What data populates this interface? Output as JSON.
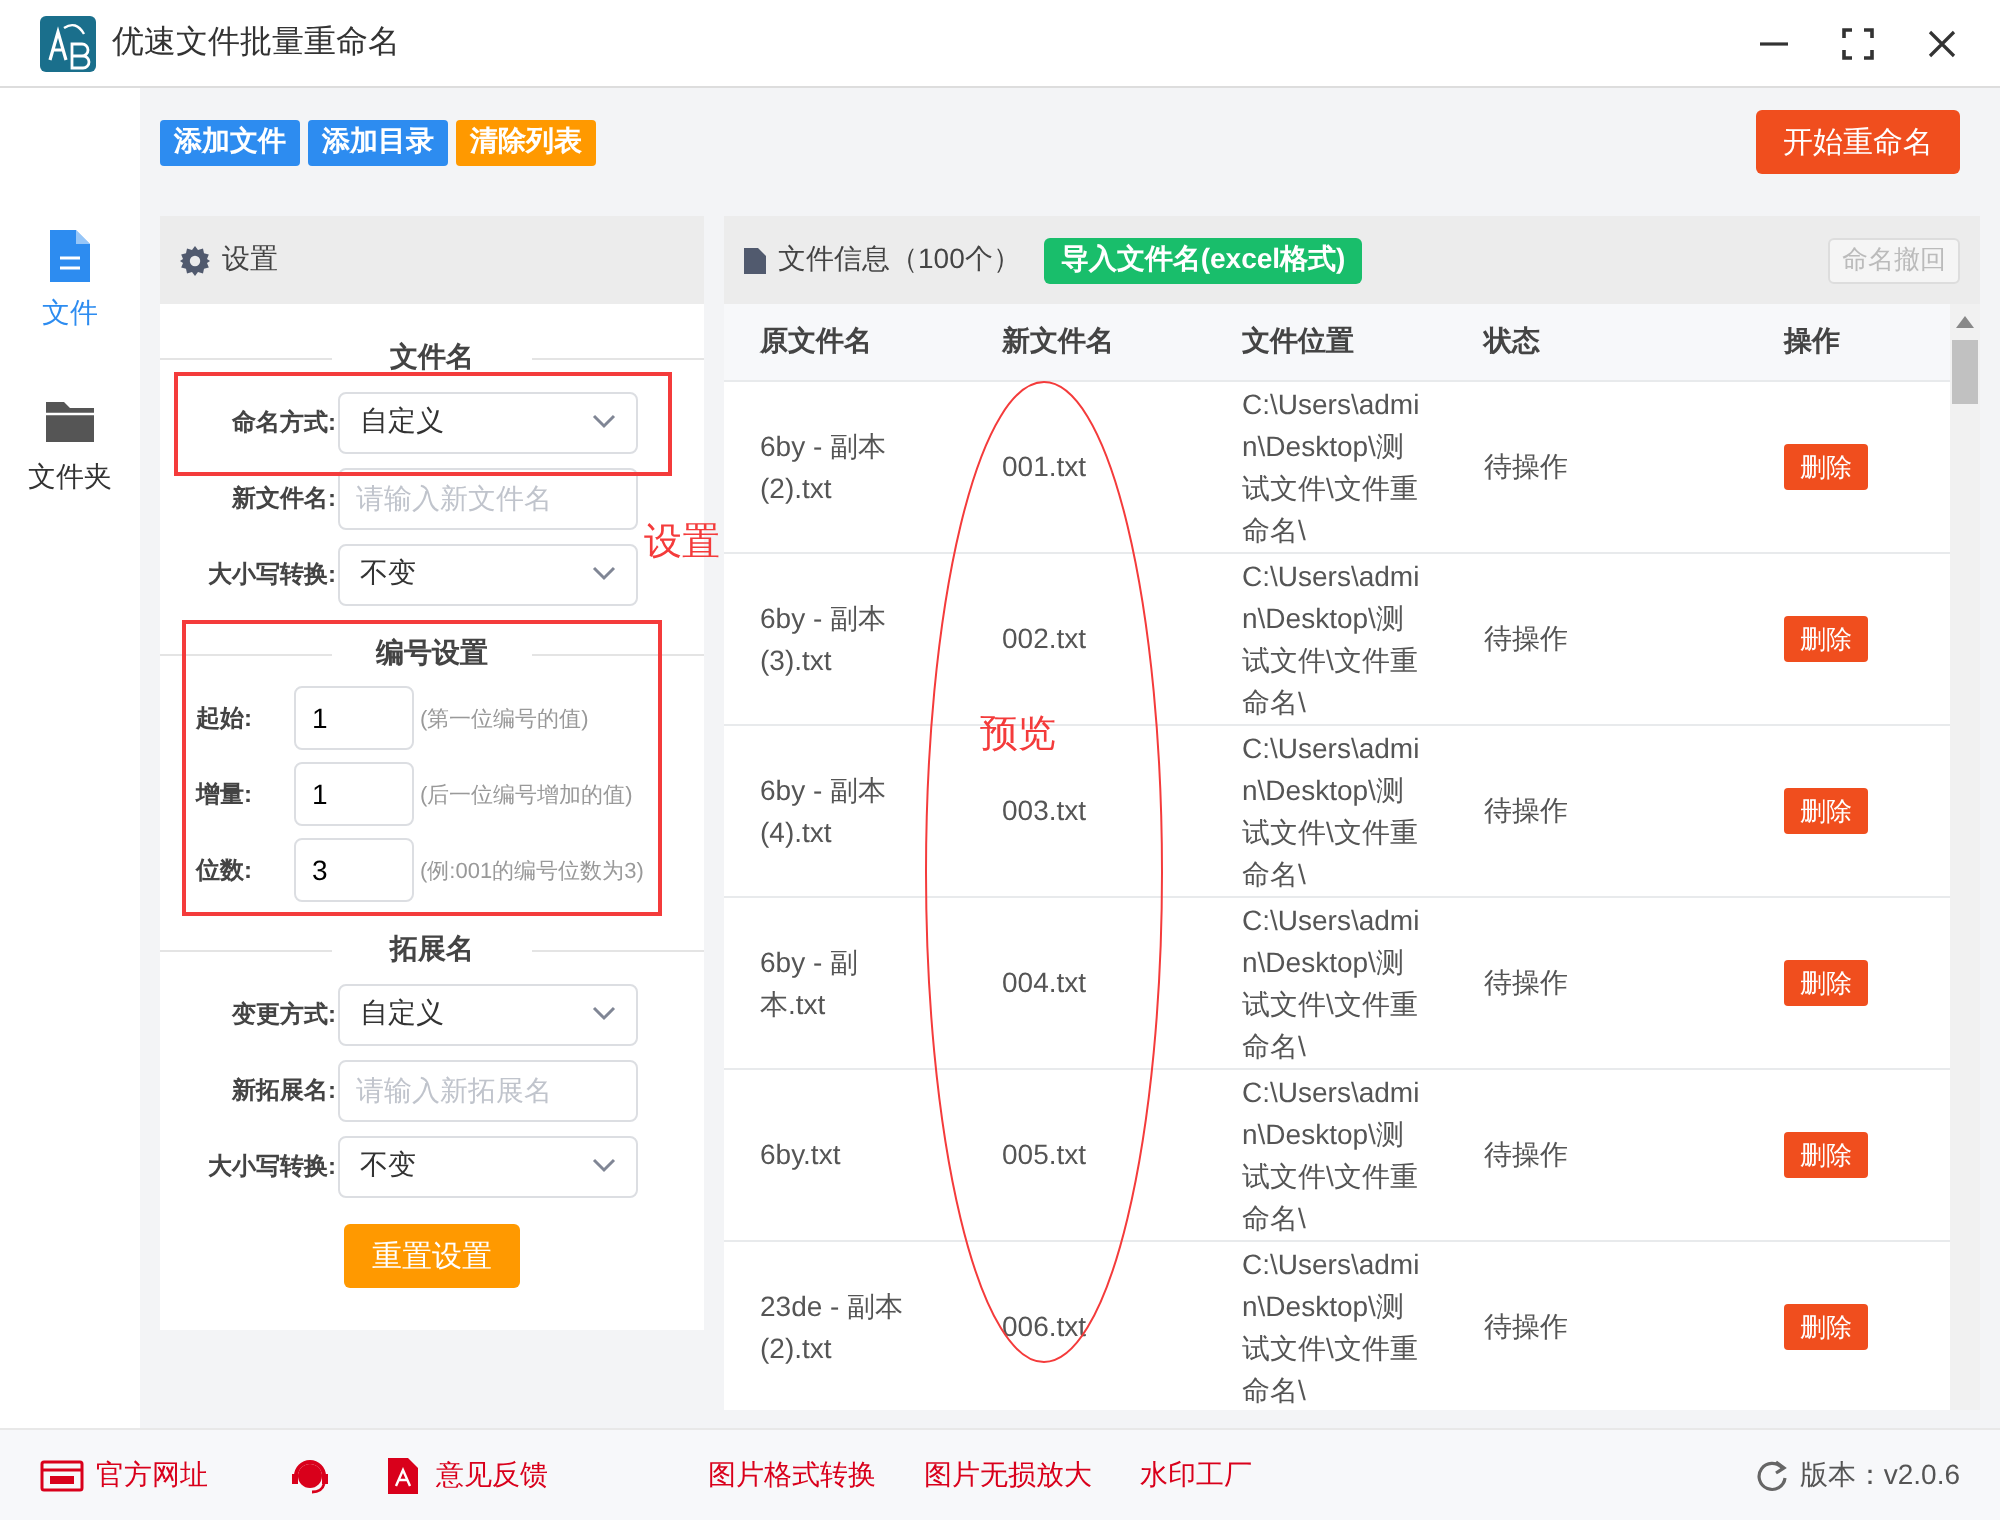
{
  "window": {
    "title": "优速文件批量重命名"
  },
  "sidebar": {
    "items": [
      {
        "label": "文件",
        "kind": "file",
        "selected": true
      },
      {
        "label": "文件夹",
        "kind": "folder",
        "selected": false
      }
    ]
  },
  "toolbar": {
    "buttons": [
      {
        "label": "添加文件",
        "kind": "primary"
      },
      {
        "label": "添加目录",
        "kind": "primary"
      },
      {
        "label": "清除列表",
        "kind": "warning"
      }
    ],
    "start_button": "开始重命名"
  },
  "settings": {
    "title": "设置",
    "sections": [
      {
        "heading": "文件名",
        "fields": [
          {
            "label": "命名方式:",
            "kind": "select",
            "value": "自定义"
          },
          {
            "label": "新文件名:",
            "kind": "input",
            "placeholder": "请输入新文件名"
          },
          {
            "label": "大小写转换:",
            "kind": "select",
            "value": "不变"
          }
        ]
      },
      {
        "heading": "编号设置",
        "fields": [
          {
            "label": "起始:",
            "kind": "number",
            "value": "1",
            "hint": "(第一位编号的值)"
          },
          {
            "label": "增量:",
            "kind": "number",
            "value": "1",
            "hint": "(后一位编号增加的值)"
          },
          {
            "label": "位数:",
            "kind": "number",
            "value": "3",
            "hint": "(例:001的编号位数为3)"
          }
        ]
      },
      {
        "heading": "拓展名",
        "fields": [
          {
            "label": "变更方式:",
            "kind": "select",
            "value": "自定义"
          },
          {
            "label": "新拓展名:",
            "kind": "input",
            "placeholder": "请输入新拓展名"
          },
          {
            "label": "大小写转换:",
            "kind": "select",
            "value": "不变"
          }
        ]
      }
    ],
    "reset_button": "重置设置"
  },
  "file_panel": {
    "title": "文件信息（100个）",
    "import_button": "导入文件名(excel格式)",
    "undo_button": {
      "label": "命名撤回",
      "disabled": true
    },
    "table": {
      "columns": [
        "原文件名",
        "新文件名",
        "文件位置",
        "状态",
        "操作"
      ],
      "rows": [
        {
          "original": "6by - 副本 (2).txt",
          "new": "001.txt",
          "location": "C:\\Users\\admin\\Desktop\\测试文件\\文件重命名\\",
          "status": "待操作",
          "action": "删除"
        },
        {
          "original": "6by - 副本 (3).txt",
          "new": "002.txt",
          "location": "C:\\Users\\admin\\Desktop\\测试文件\\文件重命名\\",
          "status": "待操作",
          "action": "删除"
        },
        {
          "original": "6by - 副本 (4).txt",
          "new": "003.txt",
          "location": "C:\\Users\\admin\\Desktop\\测试文件\\文件重命名\\",
          "status": "待操作",
          "action": "删除"
        },
        {
          "original": "6by - 副本.txt",
          "new": "004.txt",
          "location": "C:\\Users\\admin\\Desktop\\测试文件\\文件重命名\\",
          "status": "待操作",
          "action": "删除"
        },
        {
          "original": "6by.txt",
          "new": "005.txt",
          "location": "C:\\Users\\admin\\Desktop\\测试文件\\文件重命名\\",
          "status": "待操作",
          "action": "删除"
        },
        {
          "original": "23de - 副本 (2).txt",
          "new": "006.txt",
          "location": "C:\\Users\\admin\\Desktop\\测试文件\\文件重命名\\",
          "status": "待操作",
          "action": "删除"
        }
      ]
    }
  },
  "annotations": {
    "settings_label": "设置",
    "preview_label": "预览"
  },
  "footer": {
    "left_links": [
      {
        "label": "官方网址",
        "kind": "web"
      },
      {
        "kind": "support"
      },
      {
        "label": "意见反馈",
        "kind": "pdf"
      }
    ],
    "right_links": [
      "图片格式转换",
      "图片无损放大",
      "水印工厂"
    ],
    "version": "版本：v2.0.6"
  }
}
